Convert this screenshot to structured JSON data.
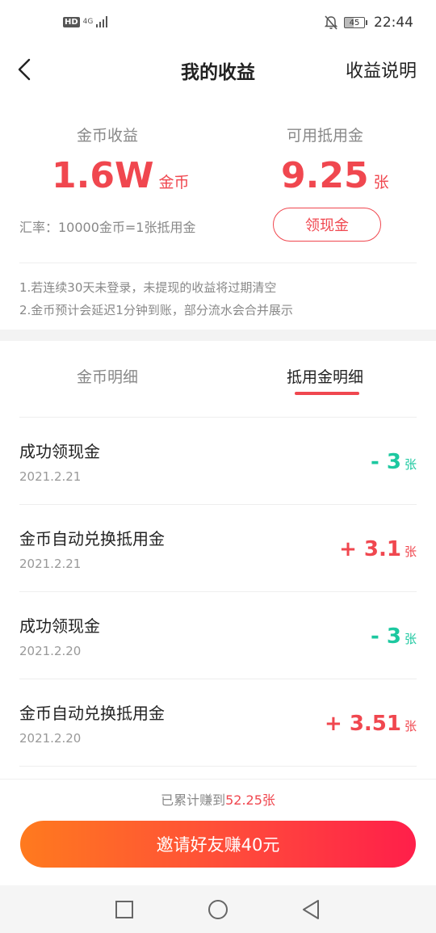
{
  "status_bar": {
    "hd": "HD",
    "network": "4G",
    "battery": "45",
    "time": "22:44"
  },
  "header": {
    "title": "我的收益",
    "right_link": "收益说明"
  },
  "summary": {
    "coins": {
      "label": "金币收益",
      "value": "1.6W",
      "unit": "金币"
    },
    "vouchers": {
      "label": "可用抵用金",
      "value": "9.25",
      "unit": "张"
    },
    "rate_text": "汇率：10000金币=1张抵用金",
    "withdraw_label": "领现金"
  },
  "notes": [
    "1.若连续30天未登录，未提现的收益将过期清空",
    "2.金币预计会延迟1分钟到账，部分流水会合并展示"
  ],
  "tabs": [
    {
      "label": "金币明细",
      "active": false
    },
    {
      "label": "抵用金明细",
      "active": true
    }
  ],
  "records": [
    {
      "title": "成功领现金",
      "date": "2021.2.21",
      "amount": "- 3",
      "unit": "张",
      "type": "minus"
    },
    {
      "title": "金币自动兑换抵用金",
      "date": "2021.2.21",
      "amount": "+ 3.1",
      "unit": "张",
      "type": "plus"
    },
    {
      "title": "成功领现金",
      "date": "2021.2.20",
      "amount": "- 3",
      "unit": "张",
      "type": "minus"
    },
    {
      "title": "金币自动兑换抵用金",
      "date": "2021.2.20",
      "amount": "+ 3.51",
      "unit": "张",
      "type": "plus"
    }
  ],
  "footer": {
    "total_prefix": "已累计赚到",
    "total_value": "52.25张",
    "invite_label": "邀请好友赚40元"
  },
  "colors": {
    "accent": "#f0474f",
    "minus": "#1dc8a0",
    "button_start": "#ff7a1e",
    "button_end": "#ff1f4a"
  },
  "icons": {
    "back": "chevron-left-icon",
    "mute": "bell-off-icon",
    "nav": [
      "square-icon",
      "circle-icon",
      "triangle-back-icon"
    ]
  }
}
